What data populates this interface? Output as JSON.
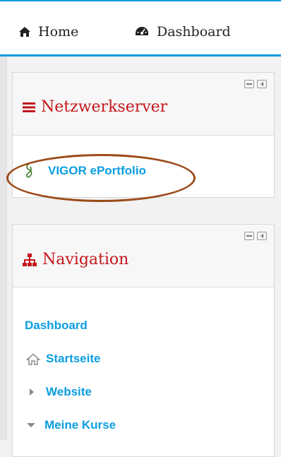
{
  "topnav": {
    "home_label": "Home",
    "dashboard_label": "Dashboard"
  },
  "netzwerk_block": {
    "title": "Netzwerkserver",
    "link_label": "VIGOR ePortfolio"
  },
  "navigation_block": {
    "title": "Navigation",
    "dashboard_link": "Dashboard",
    "startseite_link": "Startseite",
    "website_link": "Website",
    "meine_kurse_link": "Meine Kurse"
  },
  "colors": {
    "accent_blue": "#0a9de0",
    "title_red": "#c4161c",
    "annotation_brown": "#9b4a18"
  }
}
